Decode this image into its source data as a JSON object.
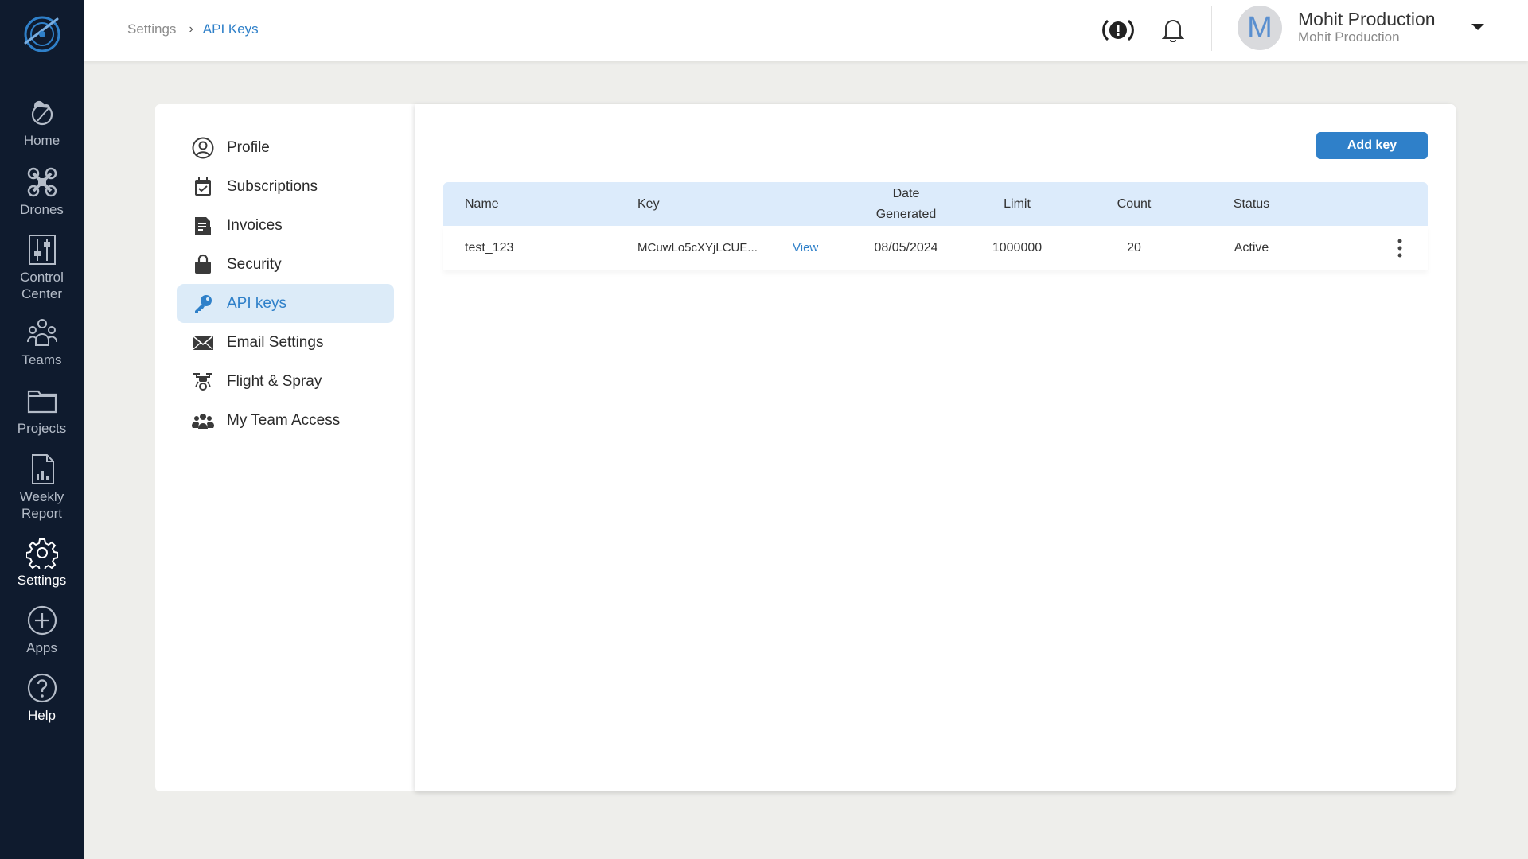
{
  "nav": {
    "items": [
      {
        "label": "Home",
        "icon": "home-drone-icon"
      },
      {
        "label": "Drones",
        "icon": "drone-icon"
      },
      {
        "label": "Control Center",
        "icon": "sliders-icon"
      },
      {
        "label": "Teams",
        "icon": "team-icon"
      },
      {
        "label": "Projects",
        "icon": "folder-icon"
      },
      {
        "label": "Weekly Report",
        "icon": "report-icon"
      },
      {
        "label": "Settings",
        "icon": "gear-icon"
      },
      {
        "label": "Apps",
        "icon": "plus-circle-icon"
      },
      {
        "label": "Help",
        "icon": "help-icon"
      }
    ],
    "active": "Settings"
  },
  "breadcrumb": {
    "parent": "Settings",
    "separator": "›",
    "current": "API Keys"
  },
  "user": {
    "initial": "M",
    "name": "Mohit Production",
    "subtitle": "Mohit Production"
  },
  "settings_menu": {
    "items": [
      {
        "label": "Profile",
        "icon": "user-circle-icon"
      },
      {
        "label": "Subscriptions",
        "icon": "calendar-check-icon"
      },
      {
        "label": "Invoices",
        "icon": "invoice-icon"
      },
      {
        "label": "Security",
        "icon": "lock-bag-icon"
      },
      {
        "label": "API keys",
        "icon": "key-icon"
      },
      {
        "label": "Email Settings",
        "icon": "envelope-icon"
      },
      {
        "label": "Flight & Spray",
        "icon": "spray-drone-icon"
      },
      {
        "label": "My Team Access",
        "icon": "users-icon"
      }
    ],
    "active": "API keys"
  },
  "main": {
    "add_button": "Add key",
    "table": {
      "headers": {
        "name": "Name",
        "key": "Key",
        "date_line1": "Date",
        "date_line2": "Generated",
        "limit": "Limit",
        "count": "Count",
        "status": "Status"
      },
      "rows": [
        {
          "name": "test_123",
          "key": "MCuwLo5cXYjLCUE...",
          "view": "View",
          "date": "08/05/2024",
          "limit": "1000000",
          "count": "20",
          "status": "Active"
        }
      ]
    }
  },
  "colors": {
    "accent": "#2f80c9",
    "nav_bg": "#0f1b2e",
    "header_row": "#dcebfb"
  }
}
